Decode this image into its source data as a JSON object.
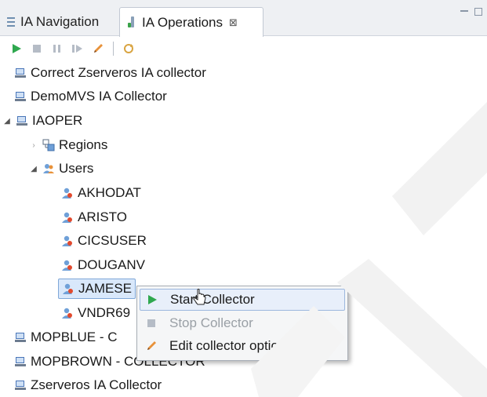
{
  "tabs": {
    "navigation": {
      "label": "IA Navigation"
    },
    "operations": {
      "label": "IA Operations",
      "close": "⊠"
    }
  },
  "toolbar": {
    "icons": [
      "play-icon",
      "stop-icon",
      "pause-icon",
      "step-icon",
      "pencil-icon",
      "refresh-icon"
    ]
  },
  "tree": {
    "nodes": [
      {
        "label": "Correct Zserveros IA collector"
      },
      {
        "label": "DemoMVS IA Collector"
      },
      {
        "label": "IAOPER"
      },
      {
        "label": "Regions"
      },
      {
        "label": "Users"
      },
      {
        "label": "AKHODAT"
      },
      {
        "label": "ARISTO"
      },
      {
        "label": "CICSUSER"
      },
      {
        "label": "DOUGANV"
      },
      {
        "label": "JAMESE"
      },
      {
        "label": "VNDR69"
      },
      {
        "label": "MOPBLUE  - C"
      },
      {
        "label": "MOPBROWN  - COLLECTOR"
      },
      {
        "label": "Zserveros IA Collector"
      }
    ]
  },
  "context_menu": {
    "items": [
      {
        "label": "Start Collector",
        "enabled": true
      },
      {
        "label": "Stop Collector",
        "enabled": false
      },
      {
        "label": "Edit collector options",
        "enabled": true
      }
    ]
  },
  "colors": {
    "accent_green": "#2fa84f",
    "selection_bg": "#d9e8fb",
    "user_icon": "#e8703a"
  }
}
